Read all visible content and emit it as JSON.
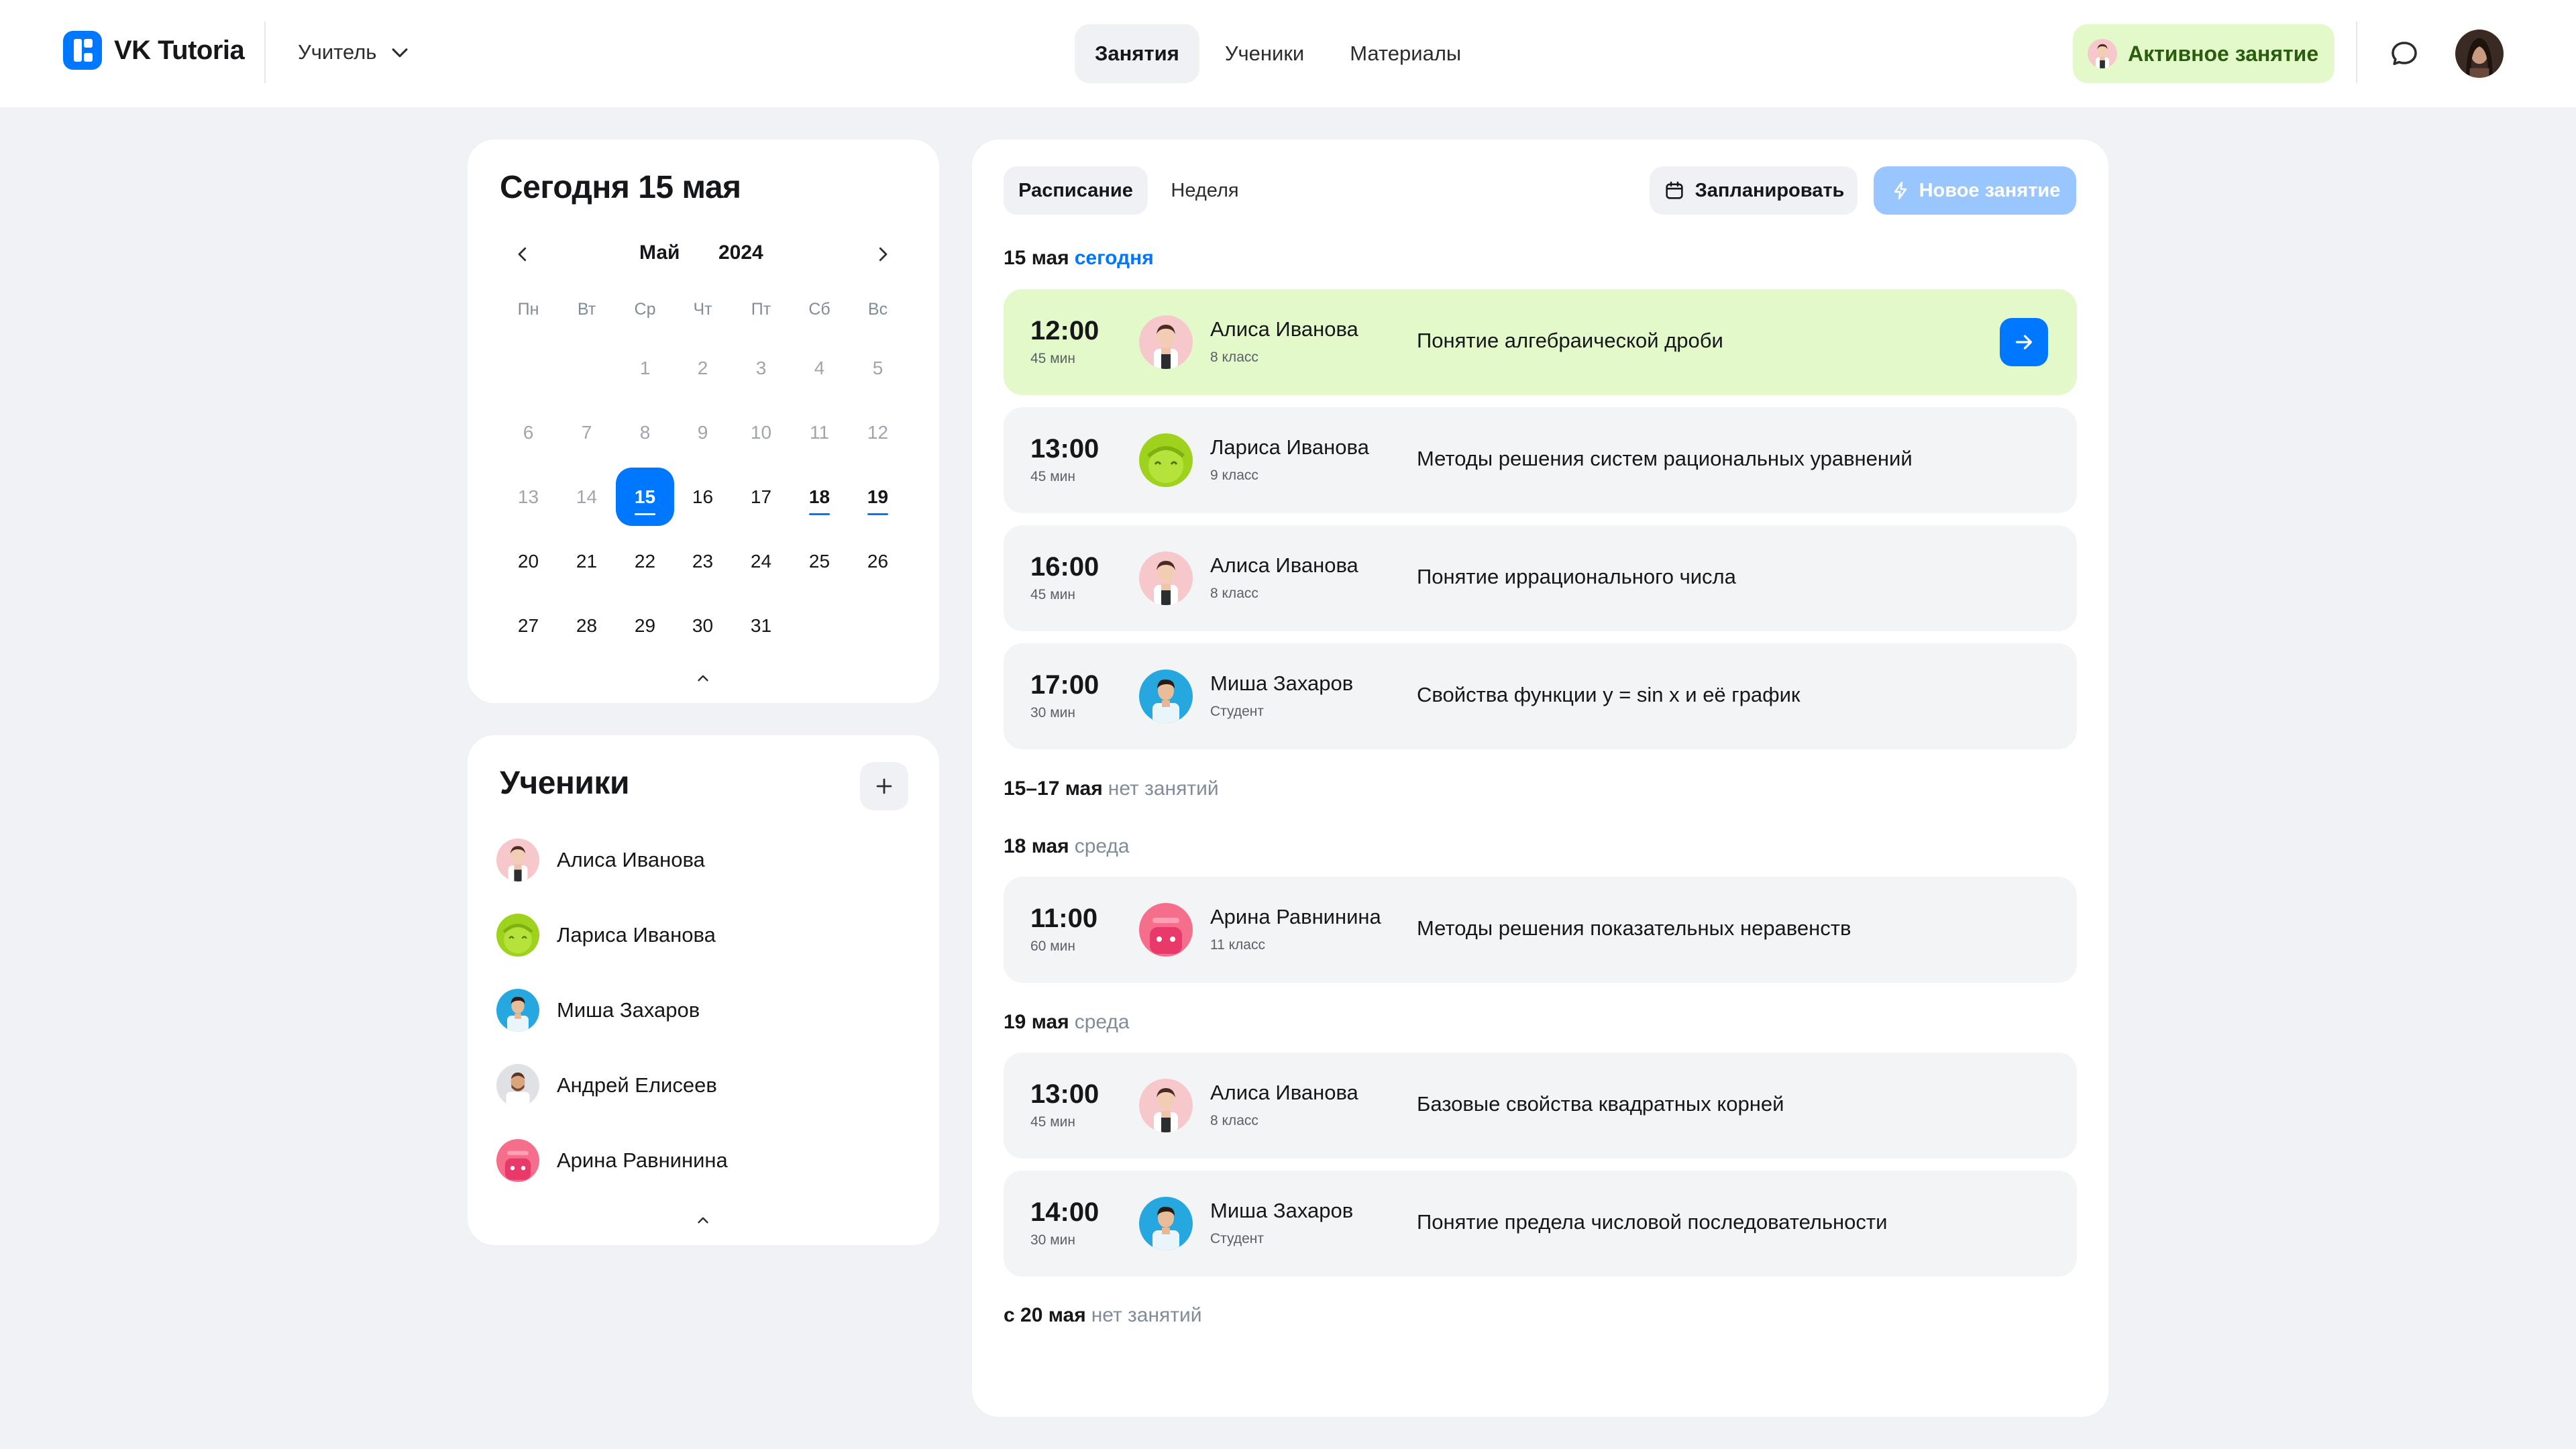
{
  "header": {
    "app_name": "VK Tutoria",
    "role": "Учитель",
    "nav": [
      {
        "label": "Занятия"
      },
      {
        "label": "Ученики"
      },
      {
        "label": "Материалы"
      }
    ],
    "active_lesson_label": "Активное занятие"
  },
  "calendar": {
    "title": "Сегодня 15 мая",
    "month": "Май",
    "year": "2024",
    "weekdays": [
      "Пн",
      "Вт",
      "Ср",
      "Чт",
      "Пт",
      "Сб",
      "Вс"
    ],
    "weeks": [
      [
        "",
        "",
        "1",
        "2",
        "3",
        "4",
        "5"
      ],
      [
        "6",
        "7",
        "8",
        "9",
        "10",
        "11",
        "12"
      ],
      [
        "13",
        "14",
        "15",
        "16",
        "17",
        "18",
        "19"
      ],
      [
        "20",
        "21",
        "22",
        "23",
        "24",
        "25",
        "26"
      ],
      [
        "27",
        "28",
        "29",
        "30",
        "31",
        "",
        ""
      ]
    ],
    "selected_day": "15",
    "marked_days": [
      "18",
      "19"
    ]
  },
  "students": {
    "title": "Ученики",
    "items": [
      {
        "name": "Алиса Иванова"
      },
      {
        "name": "Лариса Иванова"
      },
      {
        "name": "Миша Захаров"
      },
      {
        "name": "Андрей Елисеев"
      },
      {
        "name": "Арина Равнинина"
      }
    ]
  },
  "schedule": {
    "tabs": [
      {
        "label": "Расписание"
      },
      {
        "label": "Неделя"
      }
    ],
    "plan_label": "Запланировать",
    "new_label": "Новое занятие",
    "groups": [
      {
        "date": "15 мая",
        "suffix": "сегодня"
      },
      {
        "date": "15–17 мая",
        "suffix": "нет занятий"
      },
      {
        "date": "18 мая",
        "suffix": "среда"
      },
      {
        "date": "19 мая",
        "suffix": "среда"
      },
      {
        "date": "с 20 мая",
        "suffix": "нет занятий"
      }
    ],
    "lessons": [
      {
        "time": "12:00",
        "duration": "45 мин",
        "student": "Алиса Иванова",
        "grade": "8 класс",
        "topic": "Понятие алгебраической дроби"
      },
      {
        "time": "13:00",
        "duration": "45 мин",
        "student": "Лариса Иванова",
        "grade": "9 класс",
        "topic": "Методы решения систем рациональных уравнений"
      },
      {
        "time": "16:00",
        "duration": "45 мин",
        "student": "Алиса Иванова",
        "grade": "8 класс",
        "topic": "Понятие иррационального числа"
      },
      {
        "time": "17:00",
        "duration": "30 мин",
        "student": "Миша Захаров",
        "grade": "Студент",
        "topic": "Свойства функции y = sin x и её график"
      },
      {
        "time": "11:00",
        "duration": "60 мин",
        "student": "Арина Равнинина",
        "grade": "11 класс",
        "topic": "Методы решения показательных неравенств"
      },
      {
        "time": "13:00",
        "duration": "45 мин",
        "student": "Алиса Иванова",
        "grade": "8 класс",
        "topic": "Базовые свойства квадратных корней"
      },
      {
        "time": "14:00",
        "duration": "30 мин",
        "student": "Миша Захаров",
        "grade": "Студент",
        "topic": "Понятие предела числовой последовательности"
      }
    ]
  }
}
